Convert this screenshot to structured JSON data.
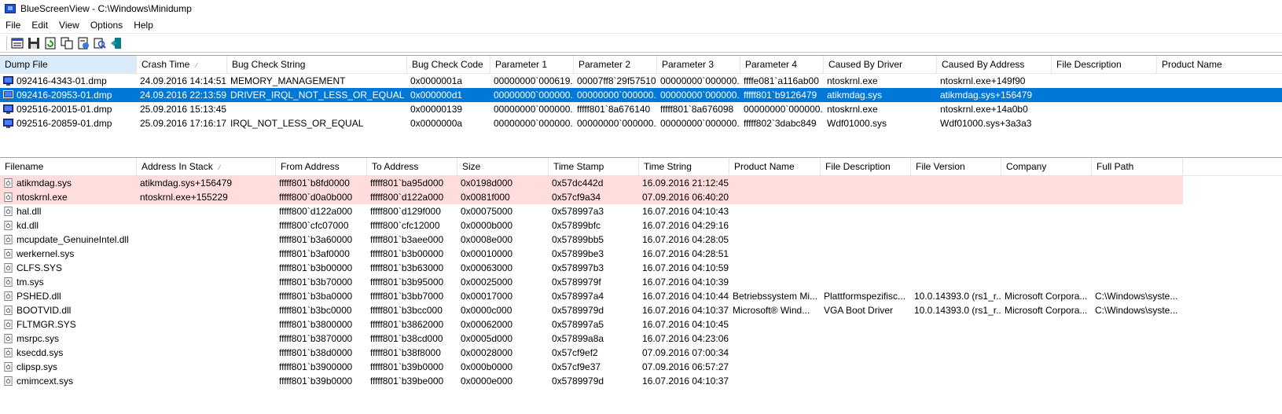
{
  "window": {
    "title": "BlueScreenView  -  C:\\Windows\\Minidump"
  },
  "menu": [
    "File",
    "Edit",
    "View",
    "Options",
    "Help"
  ],
  "toolbar": [
    "properties-icon",
    "save-icon",
    "refresh-icon",
    "copy-icon",
    "html-report-icon",
    "find-icon",
    "exit-icon"
  ],
  "dumps": {
    "columns": [
      "Dump File",
      "Crash Time",
      "Bug Check String",
      "Bug Check Code",
      "Parameter 1",
      "Parameter 2",
      "Parameter 3",
      "Parameter 4",
      "Caused By Driver",
      "Caused By Address",
      "File Description",
      "Product Name"
    ],
    "sorted_column": "Crash Time",
    "rows": [
      [
        "092416-4343-01.dmp",
        "24.09.2016 14:14:51",
        "MEMORY_MANAGEMENT",
        "0x0000001a",
        "00000000`000619...",
        "00007ff8`29f57510",
        "00000000`000000...",
        "ffffe081`a116ab00",
        "ntoskrnl.exe",
        "ntoskrnl.exe+149f90",
        "",
        ""
      ],
      [
        "092416-20953-01.dmp",
        "24.09.2016 22:13:59",
        "DRIVER_IRQL_NOT_LESS_OR_EQUAL",
        "0x000000d1",
        "00000000`000000...",
        "00000000`000000...",
        "00000000`000000...",
        "fffff801`b9126479",
        "atikmdag.sys",
        "atikmdag.sys+156479",
        "",
        ""
      ],
      [
        "092516-20015-01.dmp",
        "25.09.2016 15:13:45",
        "",
        "0x00000139",
        "00000000`000000...",
        "fffff801`8a676140",
        "fffff801`8a676098",
        "00000000`000000...",
        "ntoskrnl.exe",
        "ntoskrnl.exe+14a0b0",
        "",
        ""
      ],
      [
        "092516-20859-01.dmp",
        "25.09.2016 17:16:17",
        "IRQL_NOT_LESS_OR_EQUAL",
        "0x0000000a",
        "00000000`000000...",
        "00000000`000000...",
        "00000000`000000...",
        "fffff802`3dabc849",
        "Wdf01000.sys",
        "Wdf01000.sys+3a3a3",
        "",
        ""
      ]
    ]
  },
  "drivers": {
    "columns": [
      "Filename",
      "Address In Stack",
      "From Address",
      "To Address",
      "Size",
      "Time Stamp",
      "Time String",
      "Product Name",
      "File Description",
      "File Version",
      "Company",
      "Full Path"
    ],
    "sorted_column": "Address In Stack",
    "rows": [
      [
        "atikmdag.sys",
        "atikmdag.sys+156479",
        "fffff801`b8fd0000",
        "fffff801`ba95d000",
        "0x0198d000",
        "0x57dc442d",
        "16.09.2016 21:12:45",
        "",
        "",
        "",
        "",
        ""
      ],
      [
        "ntoskrnl.exe",
        "ntoskrnl.exe+155229",
        "fffff800`d0a0b000",
        "fffff800`d122a000",
        "0x0081f000",
        "0x57cf9a34",
        "07.09.2016 06:40:20",
        "",
        "",
        "",
        "",
        ""
      ],
      [
        "hal.dll",
        "",
        "fffff800`d122a000",
        "fffff800`d129f000",
        "0x00075000",
        "0x578997a3",
        "16.07.2016 04:10:43",
        "",
        "",
        "",
        "",
        ""
      ],
      [
        "kd.dll",
        "",
        "fffff800`cfc07000",
        "fffff800`cfc12000",
        "0x0000b000",
        "0x57899bfc",
        "16.07.2016 04:29:16",
        "",
        "",
        "",
        "",
        ""
      ],
      [
        "mcupdate_GenuineIntel.dll",
        "",
        "fffff801`b3a60000",
        "fffff801`b3aee000",
        "0x0008e000",
        "0x57899bb5",
        "16.07.2016 04:28:05",
        "",
        "",
        "",
        "",
        ""
      ],
      [
        "werkernel.sys",
        "",
        "fffff801`b3af0000",
        "fffff801`b3b00000",
        "0x00010000",
        "0x57899be3",
        "16.07.2016 04:28:51",
        "",
        "",
        "",
        "",
        ""
      ],
      [
        "CLFS.SYS",
        "",
        "fffff801`b3b00000",
        "fffff801`b3b63000",
        "0x00063000",
        "0x578997b3",
        "16.07.2016 04:10:59",
        "",
        "",
        "",
        "",
        ""
      ],
      [
        "tm.sys",
        "",
        "fffff801`b3b70000",
        "fffff801`b3b95000",
        "0x00025000",
        "0x5789979f",
        "16.07.2016 04:10:39",
        "",
        "",
        "",
        "",
        ""
      ],
      [
        "PSHED.dll",
        "",
        "fffff801`b3ba0000",
        "fffff801`b3bb7000",
        "0x00017000",
        "0x578997a4",
        "16.07.2016 04:10:44",
        "Betriebssystem Mi...",
        "Plattformspezifisc...",
        "10.0.14393.0 (rs1_r...",
        "Microsoft Corpora...",
        "C:\\Windows\\syste..."
      ],
      [
        "BOOTVID.dll",
        "",
        "fffff801`b3bc0000",
        "fffff801`b3bcc000",
        "0x0000c000",
        "0x5789979d",
        "16.07.2016 04:10:37",
        "Microsoft® Wind...",
        "VGA Boot Driver",
        "10.0.14393.0 (rs1_r...",
        "Microsoft Corpora...",
        "C:\\Windows\\syste..."
      ],
      [
        "FLTMGR.SYS",
        "",
        "fffff801`b3800000",
        "fffff801`b3862000",
        "0x00062000",
        "0x578997a5",
        "16.07.2016 04:10:45",
        "",
        "",
        "",
        "",
        ""
      ],
      [
        "msrpc.sys",
        "",
        "fffff801`b3870000",
        "fffff801`b38cd000",
        "0x0005d000",
        "0x57899a8a",
        "16.07.2016 04:23:06",
        "",
        "",
        "",
        "",
        ""
      ],
      [
        "ksecdd.sys",
        "",
        "fffff801`b38d0000",
        "fffff801`b38f8000",
        "0x00028000",
        "0x57cf9ef2",
        "07.09.2016 07:00:34",
        "",
        "",
        "",
        "",
        ""
      ],
      [
        "clipsp.sys",
        "",
        "fffff801`b3900000",
        "fffff801`b39b0000",
        "0x000b0000",
        "0x57cf9e37",
        "07.09.2016 06:57:27",
        "",
        "",
        "",
        "",
        ""
      ],
      [
        "cmimcext.sys",
        "",
        "fffff801`b39b0000",
        "fffff801`b39be000",
        "0x0000e000",
        "0x5789979d",
        "16.07.2016 04:10:37",
        "",
        "",
        "",
        "",
        ""
      ]
    ]
  }
}
